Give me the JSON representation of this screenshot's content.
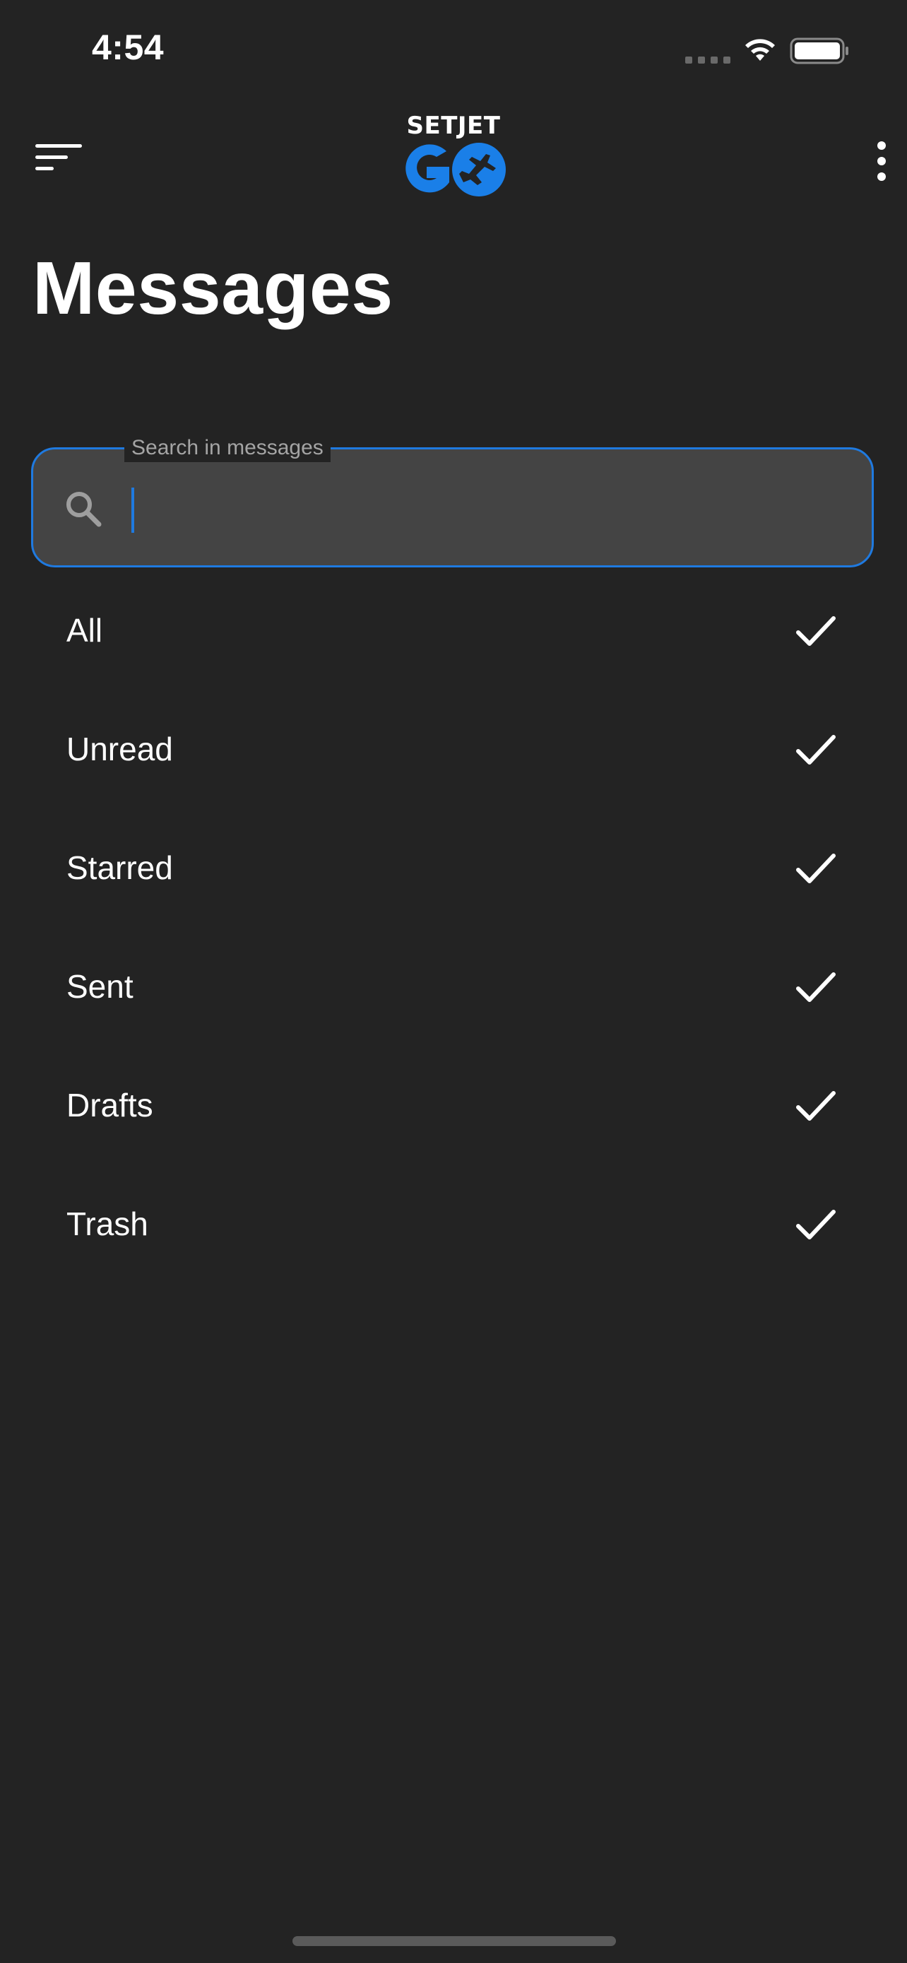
{
  "status_bar": {
    "time": "4:54"
  },
  "header": {
    "logo_top": "SETJET",
    "logo_bottom": "GO",
    "brand_color": "#1a7fe8"
  },
  "page": {
    "title": "Messages"
  },
  "search": {
    "label": "Search in messages",
    "value": "",
    "placeholder": ""
  },
  "filters": [
    {
      "label": "All",
      "checked": true
    },
    {
      "label": "Unread",
      "checked": true
    },
    {
      "label": "Starred",
      "checked": true
    },
    {
      "label": "Sent",
      "checked": true
    },
    {
      "label": "Drafts",
      "checked": true
    },
    {
      "label": "Trash",
      "checked": true
    }
  ],
  "colors": {
    "background": "#232323",
    "accent": "#1f7ae0",
    "search_fill": "#444444"
  },
  "icons": {
    "menu": "menu-icon",
    "more": "more-vertical-icon",
    "search": "search-icon",
    "check": "check-icon",
    "wifi": "wifi-icon",
    "battery": "battery-icon"
  }
}
